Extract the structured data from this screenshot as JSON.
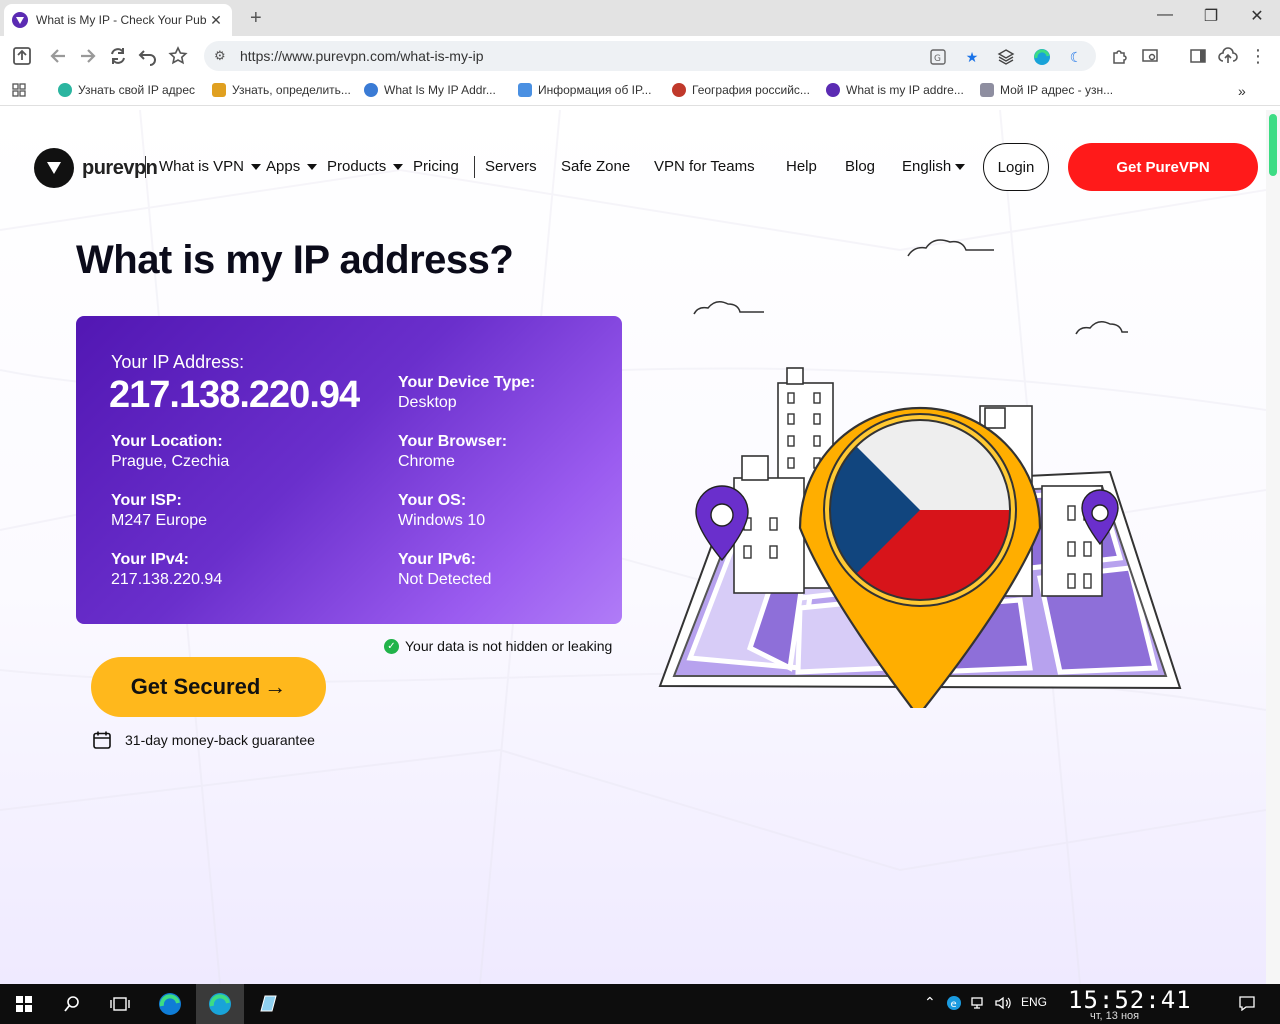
{
  "browser": {
    "tab_title": "What is My IP - Check Your Pub",
    "url": "https://www.purevpn.com/what-is-my-ip",
    "bookmarks": [
      {
        "label": "Узнать свой IP адрес",
        "color": "#2bb5a0"
      },
      {
        "label": "Узнать, определить...",
        "color": "#e0a020"
      },
      {
        "label": "What Is My IP Addr...",
        "color": "#3a7bd5"
      },
      {
        "label": "Информация об IP...",
        "color": "#4a90e2"
      },
      {
        "label": "География российс...",
        "color": "#c0392b"
      },
      {
        "label": "What is my IP addre...",
        "color": "#5b2bb3"
      },
      {
        "label": "Мой IP адрес - узн...",
        "color": "#8e8ea0"
      }
    ]
  },
  "nav": {
    "logo_text": "purevpn",
    "items": [
      {
        "label": "What is VPN",
        "dropdown": true
      },
      {
        "label": "Apps",
        "dropdown": true
      },
      {
        "label": "Products",
        "dropdown": true
      },
      {
        "label": "Pricing",
        "dropdown": false
      },
      {
        "label": "Servers",
        "dropdown": false
      },
      {
        "label": "Safe Zone",
        "dropdown": false
      },
      {
        "label": "VPN for Teams",
        "dropdown": false
      },
      {
        "label": "Help",
        "dropdown": false
      },
      {
        "label": "Blog",
        "dropdown": false
      },
      {
        "label": "English",
        "dropdown": true
      }
    ],
    "login": "Login",
    "cta": "Get PureVPN"
  },
  "hero": {
    "title": "What is my IP address?"
  },
  "ip_card": {
    "ip_label": "Your IP Address:",
    "ip_value": "217.138.220.94",
    "location_label": "Your Location:",
    "location_value": "Prague, Czechia",
    "isp_label": "Your ISP:",
    "isp_value": "M247 Europe",
    "ipv4_label": "Your IPv4:",
    "ipv4_value": "217.138.220.94",
    "device_label": "Your Device Type:",
    "device_value": "Desktop",
    "browser_label": "Your Browser:",
    "browser_value": "Chrome",
    "os_label": "Your OS:",
    "os_value": "Windows 10",
    "ipv6_label": "Your IPv6:",
    "ipv6_value": "Not Detected"
  },
  "status": {
    "text": "Your data is not hidden or leaking"
  },
  "cta": {
    "secure": "Get Secured",
    "secure_arrow": "→",
    "guarantee": "31-day money-back guarantee"
  },
  "colors": {
    "accent_red": "#ff1a1a",
    "accent_yellow": "#ffb81c",
    "card_purple": "#6a2fcc",
    "ok_green": "#21b34a"
  },
  "taskbar": {
    "lang": "ENG",
    "time": "15:52:41",
    "date": "чт, 13 ноя"
  }
}
